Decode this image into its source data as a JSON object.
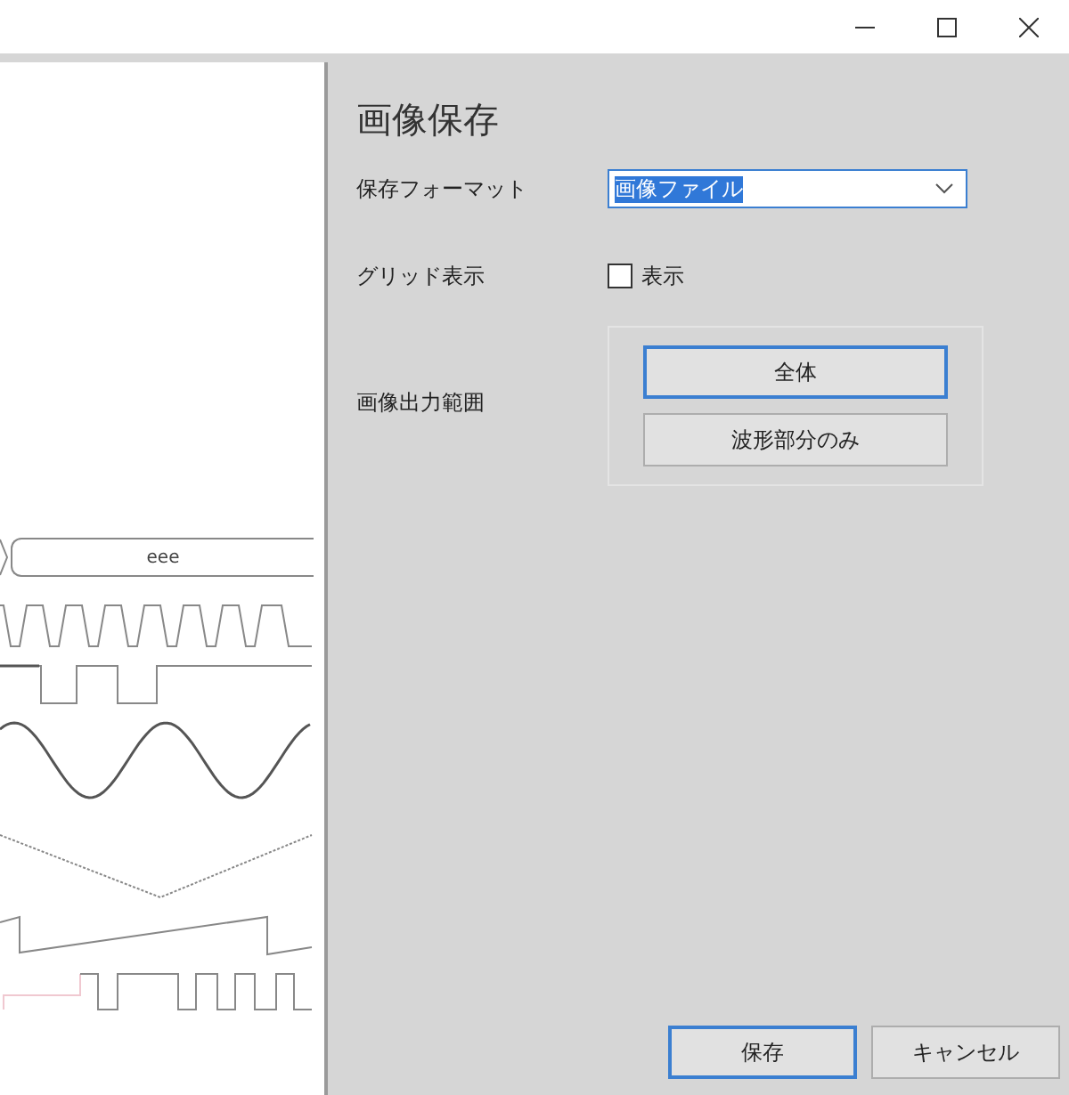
{
  "window": {
    "buttons": [
      {
        "kind": "minimize"
      },
      {
        "kind": "maximize"
      },
      {
        "kind": "close"
      }
    ]
  },
  "preview": {
    "bus_value": "eee"
  },
  "dialog": {
    "title": "画像保存",
    "format": {
      "label": "保存フォーマット",
      "value": "画像ファイル"
    },
    "grid": {
      "label": "グリッド表示",
      "checkbox_label": "表示",
      "checked": false
    },
    "range": {
      "label": "画像出力範囲",
      "options": [
        {
          "label": "全体",
          "selected": true
        },
        {
          "label": "波形部分のみ",
          "selected": false
        }
      ]
    },
    "buttons": [
      {
        "label": "保存",
        "default": true
      },
      {
        "label": "キャンセル",
        "default": false
      }
    ]
  }
}
